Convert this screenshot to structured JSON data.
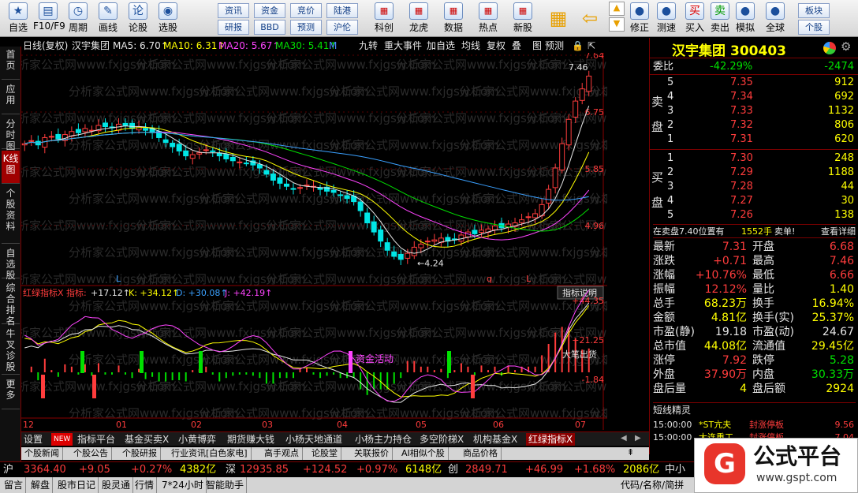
{
  "toolbar": {
    "main": [
      {
        "label": "自选",
        "icon": "★"
      },
      {
        "label": "F10/F9",
        "icon": "▤"
      },
      {
        "label": "周期",
        "icon": "◷"
      },
      {
        "label": "画线",
        "icon": "✎"
      },
      {
        "label": "论股",
        "icon": "论"
      },
      {
        "label": "选股",
        "icon": "◉"
      }
    ],
    "mini_row1": [
      "资讯",
      "资金",
      "竞价",
      "陆港"
    ],
    "mini_row2": [
      "研报",
      "BBD",
      "预测",
      "沪伦"
    ],
    "icons2": [
      {
        "label": "科创"
      },
      {
        "label": "龙虎"
      },
      {
        "label": "数据"
      },
      {
        "label": "热点"
      },
      {
        "label": "新股"
      }
    ],
    "right": [
      {
        "label": "修正"
      },
      {
        "label": "测速"
      },
      {
        "label": "买入"
      },
      {
        "label": "卖出"
      },
      {
        "label": "模拟"
      },
      {
        "label": "全球"
      }
    ],
    "mini_right1": "板块",
    "mini_right2": "个股"
  },
  "leftnav": [
    "首页",
    "应用",
    "分时图",
    "K线图",
    "个股资料",
    "自选股",
    "综合排名",
    "牛叉诊股",
    "更多"
  ],
  "chartbar": {
    "period": "日线(复权)",
    "stock": "汉宇集团",
    "ma5": "MA5: 6.70↑",
    "ma10": "MA10: 6.31↑",
    "ma20": "MA20: 5.67↑",
    "ma30": "MA30: 5.41↑",
    "m": "M",
    "menu": [
      "九转",
      "重大事件",
      "加自选",
      "均线",
      "复权",
      "叠",
      "图",
      "预测"
    ]
  },
  "main_axis": [
    "7.64",
    "6.75",
    "5.85",
    "4.96"
  ],
  "main_labels": {
    "high": "7.46",
    "low": "4.24",
    "l1": "L",
    "l2": "L",
    "q": "q"
  },
  "indicator": {
    "name": "红绿指标X",
    "label": "指标:",
    "val": "+17.12↑",
    "k": "K: +34.12↑",
    "d": "D: +30.08↑",
    "j": "J: +42.19↑",
    "explain": "指标说明",
    "axis": [
      "+44.35",
      "+21.25",
      "-1.84"
    ],
    "note1": "资金活动",
    "note2": "大笔出货"
  },
  "months": [
    "12",
    "01",
    "02",
    "03",
    "04",
    "05",
    "06",
    "07"
  ],
  "watermark": "分析家公式网www.fxjgsw.Com",
  "chart_data": {
    "type": "candlestick",
    "ylim": [
      4.0,
      7.64
    ],
    "high": 7.46,
    "low": 4.24,
    "ma": [
      {
        "name": "MA5",
        "value": 6.7
      },
      {
        "name": "MA10",
        "value": 6.31
      },
      {
        "name": "MA20",
        "value": 5.67
      },
      {
        "name": "MA30",
        "value": 5.41
      }
    ],
    "closes": [
      6.2,
      6.25,
      6.18,
      6.3,
      6.32,
      6.28,
      6.35,
      6.4,
      6.38,
      6.45,
      6.42,
      6.5,
      6.48,
      6.46,
      6.52,
      6.5,
      6.45,
      6.48,
      6.42,
      6.38,
      6.3,
      6.22,
      6.15,
      6.08,
      6.0,
      6.02,
      6.05,
      6.1,
      6.08,
      6.0,
      5.95,
      5.92,
      5.9,
      5.88,
      5.85,
      5.8,
      5.7,
      5.6,
      5.55,
      5.5,
      5.45,
      5.48,
      5.52,
      5.5,
      5.45,
      5.42,
      5.4,
      5.35,
      5.3,
      5.25,
      5.1,
      4.9,
      4.75,
      4.6,
      4.45,
      4.35,
      4.3,
      4.4,
      4.5,
      4.55,
      4.6,
      4.62,
      4.65,
      4.6,
      4.62,
      4.7,
      4.75,
      4.72,
      4.78,
      4.8,
      4.85,
      4.82,
      4.88,
      4.9,
      4.95,
      5.0,
      5.05,
      5.2,
      5.45,
      5.8,
      6.2,
      6.6,
      6.9,
      7.1,
      7.31
    ]
  },
  "quote": {
    "name": "汉宇集团",
    "code": "300403",
    "webi": "委比",
    "webi_pct": "-42.29%",
    "webi_diff": "-2474",
    "sells": [
      {
        "n": "5",
        "p": "7.35",
        "v": "912"
      },
      {
        "n": "4",
        "p": "7.34",
        "v": "692"
      },
      {
        "n": "3",
        "p": "7.33",
        "v": "1132"
      },
      {
        "n": "2",
        "p": "7.32",
        "v": "806"
      },
      {
        "n": "1",
        "p": "7.31",
        "v": "620"
      }
    ],
    "buys": [
      {
        "n": "1",
        "p": "7.30",
        "v": "248"
      },
      {
        "n": "2",
        "p": "7.29",
        "v": "1188"
      },
      {
        "n": "3",
        "p": "7.28",
        "v": "44"
      },
      {
        "n": "4",
        "p": "7.27",
        "v": "30"
      },
      {
        "n": "5",
        "p": "7.26",
        "v": "138"
      }
    ],
    "sell_lbl": "卖",
    "pan1": "盘",
    "buy_lbl": "买",
    "pan2": "盘",
    "inline_a": "在卖盘7.40位置有",
    "inline_b": "1552手",
    "inline_c": "卖单!",
    "inline_d": "查看详细",
    "stats": [
      [
        "最新",
        "7.31",
        "开盘",
        "6.68"
      ],
      [
        "涨跌",
        "+0.71",
        "最高",
        "7.46"
      ],
      [
        "涨幅",
        "+10.76%",
        "最低",
        "6.66"
      ],
      [
        "振幅",
        "12.12%",
        "量比",
        "1.40"
      ],
      [
        "总手",
        "68.23万",
        "换手",
        "16.94%"
      ],
      [
        "金额",
        "4.81亿",
        "换手(实)",
        "25.37%"
      ],
      [
        "市盈(静)",
        "19.18",
        "市盈(动)",
        "24.67"
      ],
      [
        "总市值",
        "44.08亿",
        "流通值",
        "29.45亿"
      ],
      [
        "涨停",
        "7.92",
        "跌停",
        "5.28"
      ],
      [
        "外盘",
        "37.90万",
        "内盘",
        "30.33万"
      ],
      [
        "盘后量",
        "4",
        "盘后额",
        "2924"
      ]
    ],
    "short_title": "短线精灵",
    "short": [
      [
        "15:00:00",
        "*ST亢夫",
        "封涨停板",
        "9.56"
      ],
      [
        "15:00:00",
        "大连重工",
        "封涨停板",
        "7.04"
      ]
    ]
  },
  "bottom_tabs": [
    "设置",
    "NEW",
    "指标平台",
    "基金买卖X",
    "小黄博弈",
    "期货赚大钱",
    "小杨天地通道",
    "小杨主力持仓",
    "多空阶梯X",
    "机构基金X",
    "红绿指标X"
  ],
  "info_tabs": [
    "个股新闻",
    "个股公告",
    "个股研报",
    "行业资讯[白色家电]",
    "高手观点",
    "论股堂",
    "关联报价",
    "AI相似个股",
    "商品价格"
  ],
  "ticker": {
    "sh": "沪",
    "sh_v": "3364.40",
    "sh_c": "+9.05",
    "sh_p": "+0.27%",
    "sh_a": "4382亿",
    "sz": "深",
    "sz_v": "12935.85",
    "sz_c": "+124.52",
    "sz_p": "+0.97%",
    "sz_a": "6148亿",
    "cy": "创",
    "cy_v": "2849.71",
    "cy_c": "+46.99",
    "cy_p": "+1.68%",
    "cy_a": "2086亿",
    "zx": "中小"
  },
  "status": [
    "留言",
    "解盘",
    "股市日记",
    "股灵通",
    "行情",
    "7*24小时",
    "智能助手"
  ],
  "status_r": "代码/名称/简拼",
  "brand": {
    "name": "公式平台",
    "url": "www.gspt.com"
  }
}
